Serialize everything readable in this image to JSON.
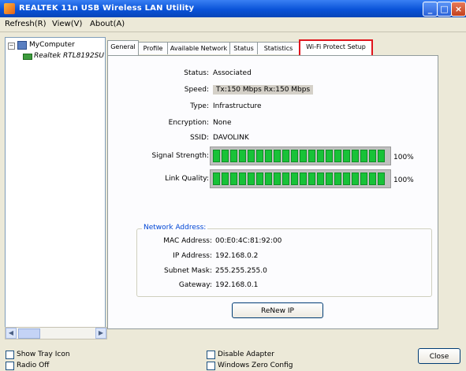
{
  "window": {
    "title": "REALTEK 11n USB Wireless LAN Utility",
    "controls": [
      "_",
      "□",
      "×"
    ]
  },
  "menu": [
    "Refresh(R)",
    "View(V)",
    "About(A)"
  ],
  "tree": {
    "root_label": "MyComputer",
    "adapter_label": "Realtek RTL8192SU"
  },
  "tabs": [
    "General",
    "Profile",
    "Available Network",
    "Status",
    "Statistics",
    "Wi-Fi Protect Setup"
  ],
  "general": {
    "fields": [
      {
        "label": "Status:",
        "value": "Associated"
      },
      {
        "label": "Speed:",
        "value": "Tx:150 Mbps Rx:150 Mbps",
        "boxed": true
      },
      {
        "label": "Type:",
        "value": "Infrastructure"
      },
      {
        "label": "Encryption:",
        "value": "None"
      },
      {
        "label": "SSID:",
        "value": "DAVOLINK"
      }
    ],
    "signal": {
      "label": "Signal Strength:",
      "percent_text": "100%",
      "level": 1.0
    },
    "quality": {
      "label": "Link Quality:",
      "percent_text": "100%",
      "level": 1.0
    }
  },
  "network_address": {
    "title": "Network Address:",
    "rows": [
      {
        "label": "MAC Address:",
        "value": "00:E0:4C:81:92:00"
      },
      {
        "label": "IP Address:",
        "value": "192.168.0.2"
      },
      {
        "label": "Subnet Mask:",
        "value": "255.255.255.0"
      },
      {
        "label": "Gateway:",
        "value": "192.168.0.1"
      }
    ]
  },
  "renew_button": "ReNew IP",
  "bottom": {
    "show_tray_icon": "Show Tray Icon",
    "radio_off": "Radio Off",
    "disable_adapter": "Disable Adapter",
    "windows_zero_config": "Windows Zero Config",
    "close_button": "Close"
  }
}
